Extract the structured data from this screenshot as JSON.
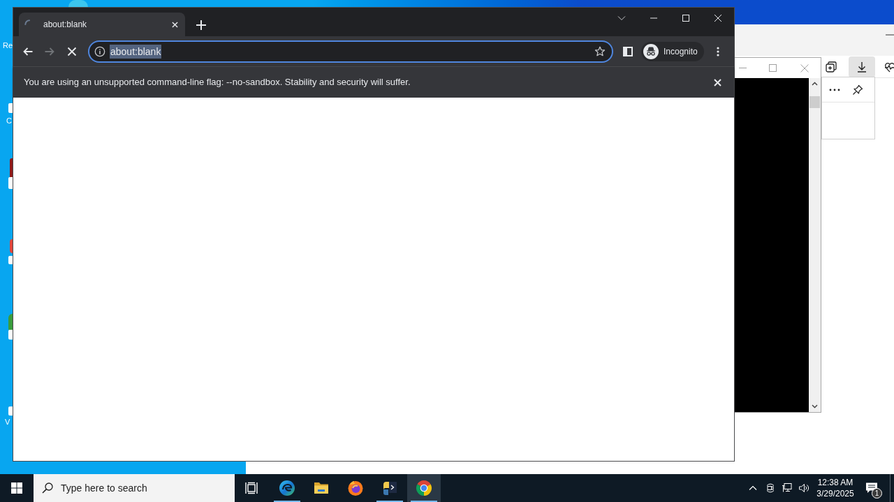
{
  "desktop": {
    "icon_labels": [
      "Re",
      "C",
      "V"
    ]
  },
  "background_window": {
    "toolbar_buttons": [
      {
        "kind": "collections",
        "selected": false
      },
      {
        "kind": "downloads",
        "selected": true
      },
      {
        "kind": "health",
        "selected": false
      }
    ]
  },
  "browser": {
    "tabs": [
      {
        "title": "about:blank",
        "selected": true,
        "loading": true
      }
    ],
    "nav_buttons": [
      {
        "kind": "back",
        "disabled": false
      },
      {
        "kind": "forward",
        "disabled": true
      },
      {
        "kind": "stop",
        "disabled": false
      }
    ],
    "address_bar": {
      "value": "about:blank",
      "focused": true,
      "text_selected": true
    },
    "profile": {
      "label": "Incognito"
    },
    "infobar": {
      "message": "You are using an unsupported command-line flag: --no-sandbox. Stability and security will suffer."
    }
  },
  "taskbar": {
    "search": {
      "placeholder": "Type here to search"
    },
    "apps": [
      {
        "kind": "edge",
        "running": true,
        "selected": false
      },
      {
        "kind": "file-explorer",
        "running": false,
        "selected": false
      },
      {
        "kind": "firefox",
        "running": false,
        "selected": false
      },
      {
        "kind": "python",
        "running": true,
        "selected": false
      },
      {
        "kind": "chrome",
        "running": true,
        "selected": true
      }
    ],
    "clock": {
      "time": "12:38 AM",
      "date": "3/29/2025"
    },
    "notifications": {
      "count": "1"
    }
  }
}
